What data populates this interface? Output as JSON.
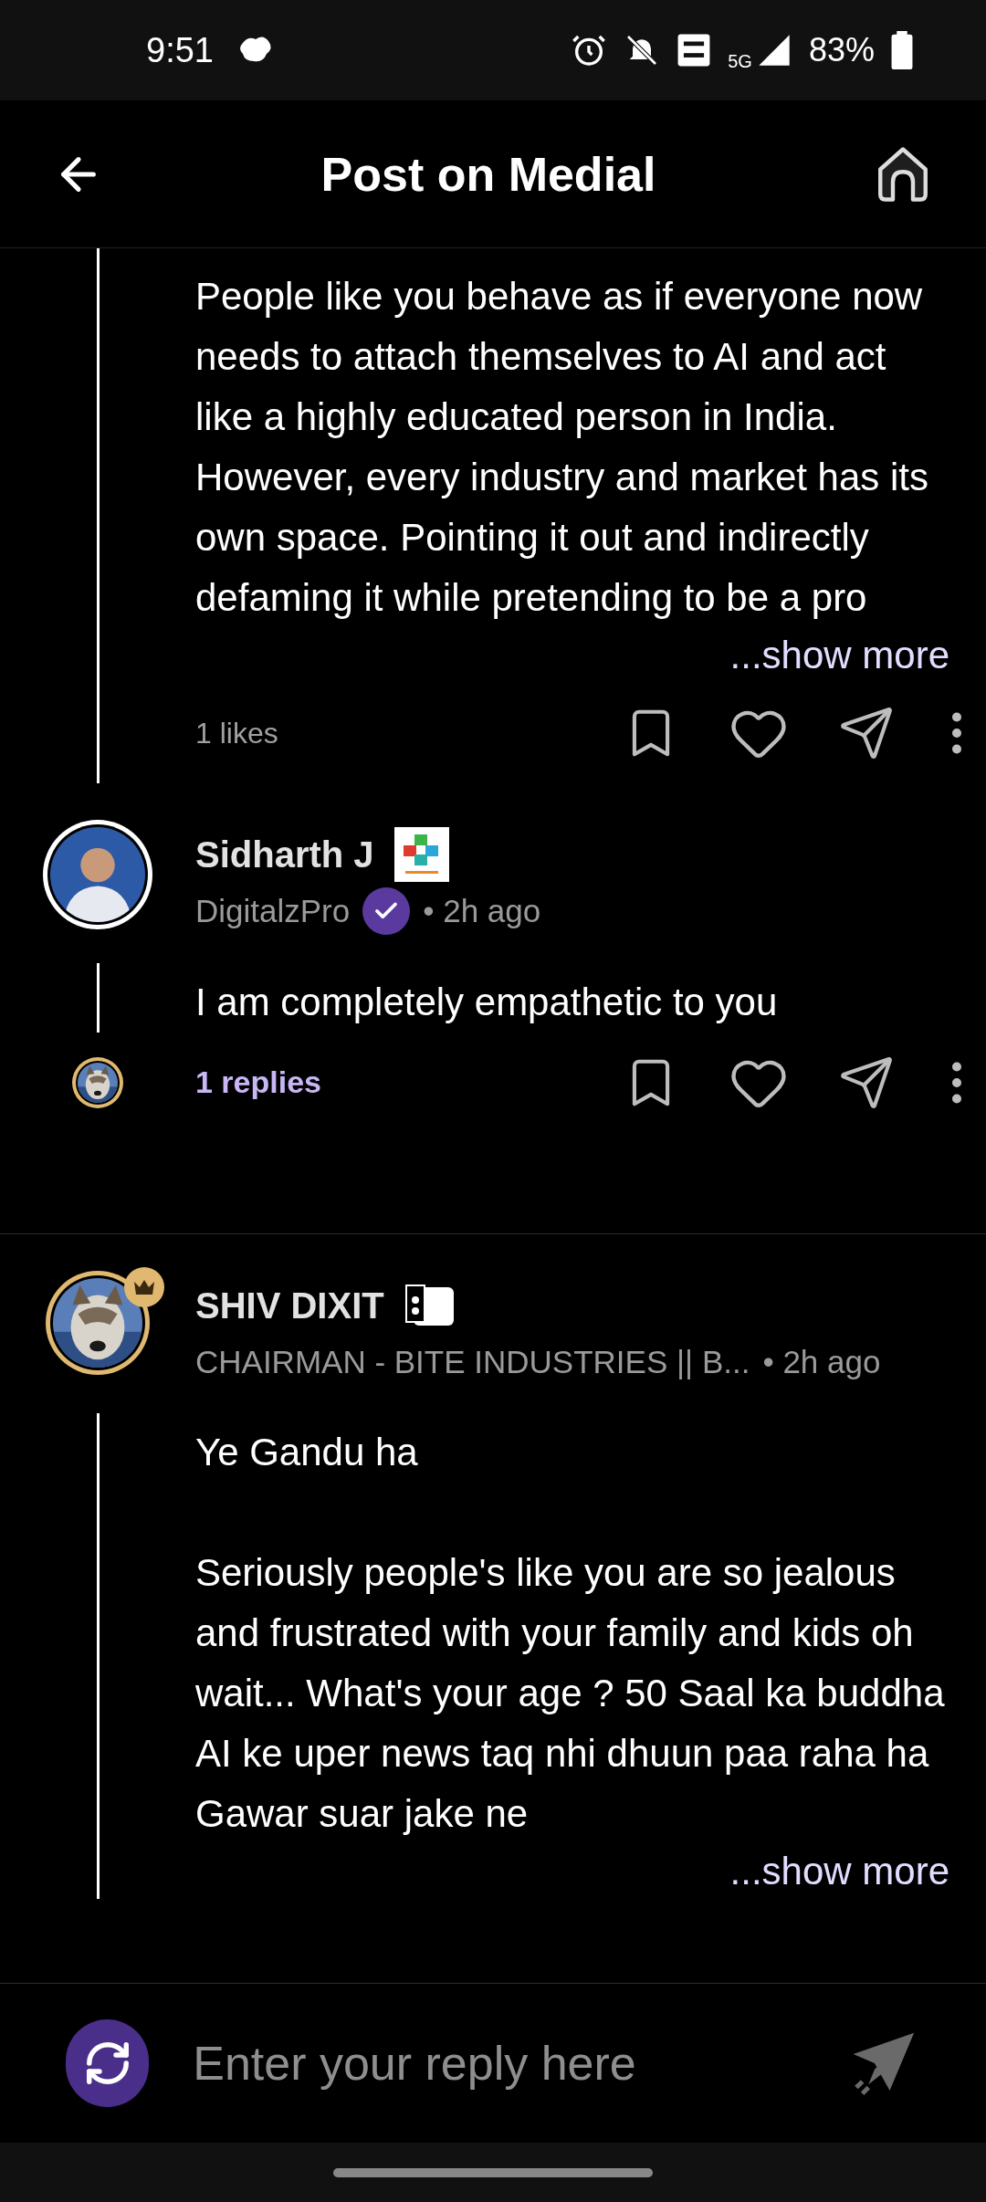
{
  "status_bar": {
    "time": "9:51",
    "network": "5G",
    "battery": "83%"
  },
  "header": {
    "title": "Post on Medial"
  },
  "comments": [
    {
      "kind": "continuation",
      "paragraphs": [
        "People like you behave as if everyone now needs to attach themselves to AI and act like a highly educated person in India. However, every industry and market has its own space. Pointing it out and indirectly defaming it while pretending to be a pro"
      ],
      "show_more": "...show more",
      "likes": "1 likes"
    },
    {
      "kind": "full",
      "author": "Sidharth J",
      "org": "DigitalzPro",
      "verified": true,
      "crowned": false,
      "time": "• 2h ago",
      "paragraphs": [
        "I am completely empathetic to you"
      ],
      "replies": "1 replies"
    },
    {
      "kind": "full",
      "author": "SHIV DIXIT",
      "org": "CHAIRMAN - BITE INDUSTRIES || B...",
      "verified": false,
      "crowned": true,
      "time": "• 2h ago",
      "paragraphs": [
        "Ye Gandu ha",
        "Seriously people's like you are so jealous and frustrated with your family and kids oh wait... What's your age ? 50 Saal ka buddha AI ke uper news taq nhi dhuun paa raha ha Gawar suar jake ne"
      ],
      "show_more": "...show more"
    }
  ],
  "reply_bar": {
    "placeholder": "Enter your reply here"
  }
}
